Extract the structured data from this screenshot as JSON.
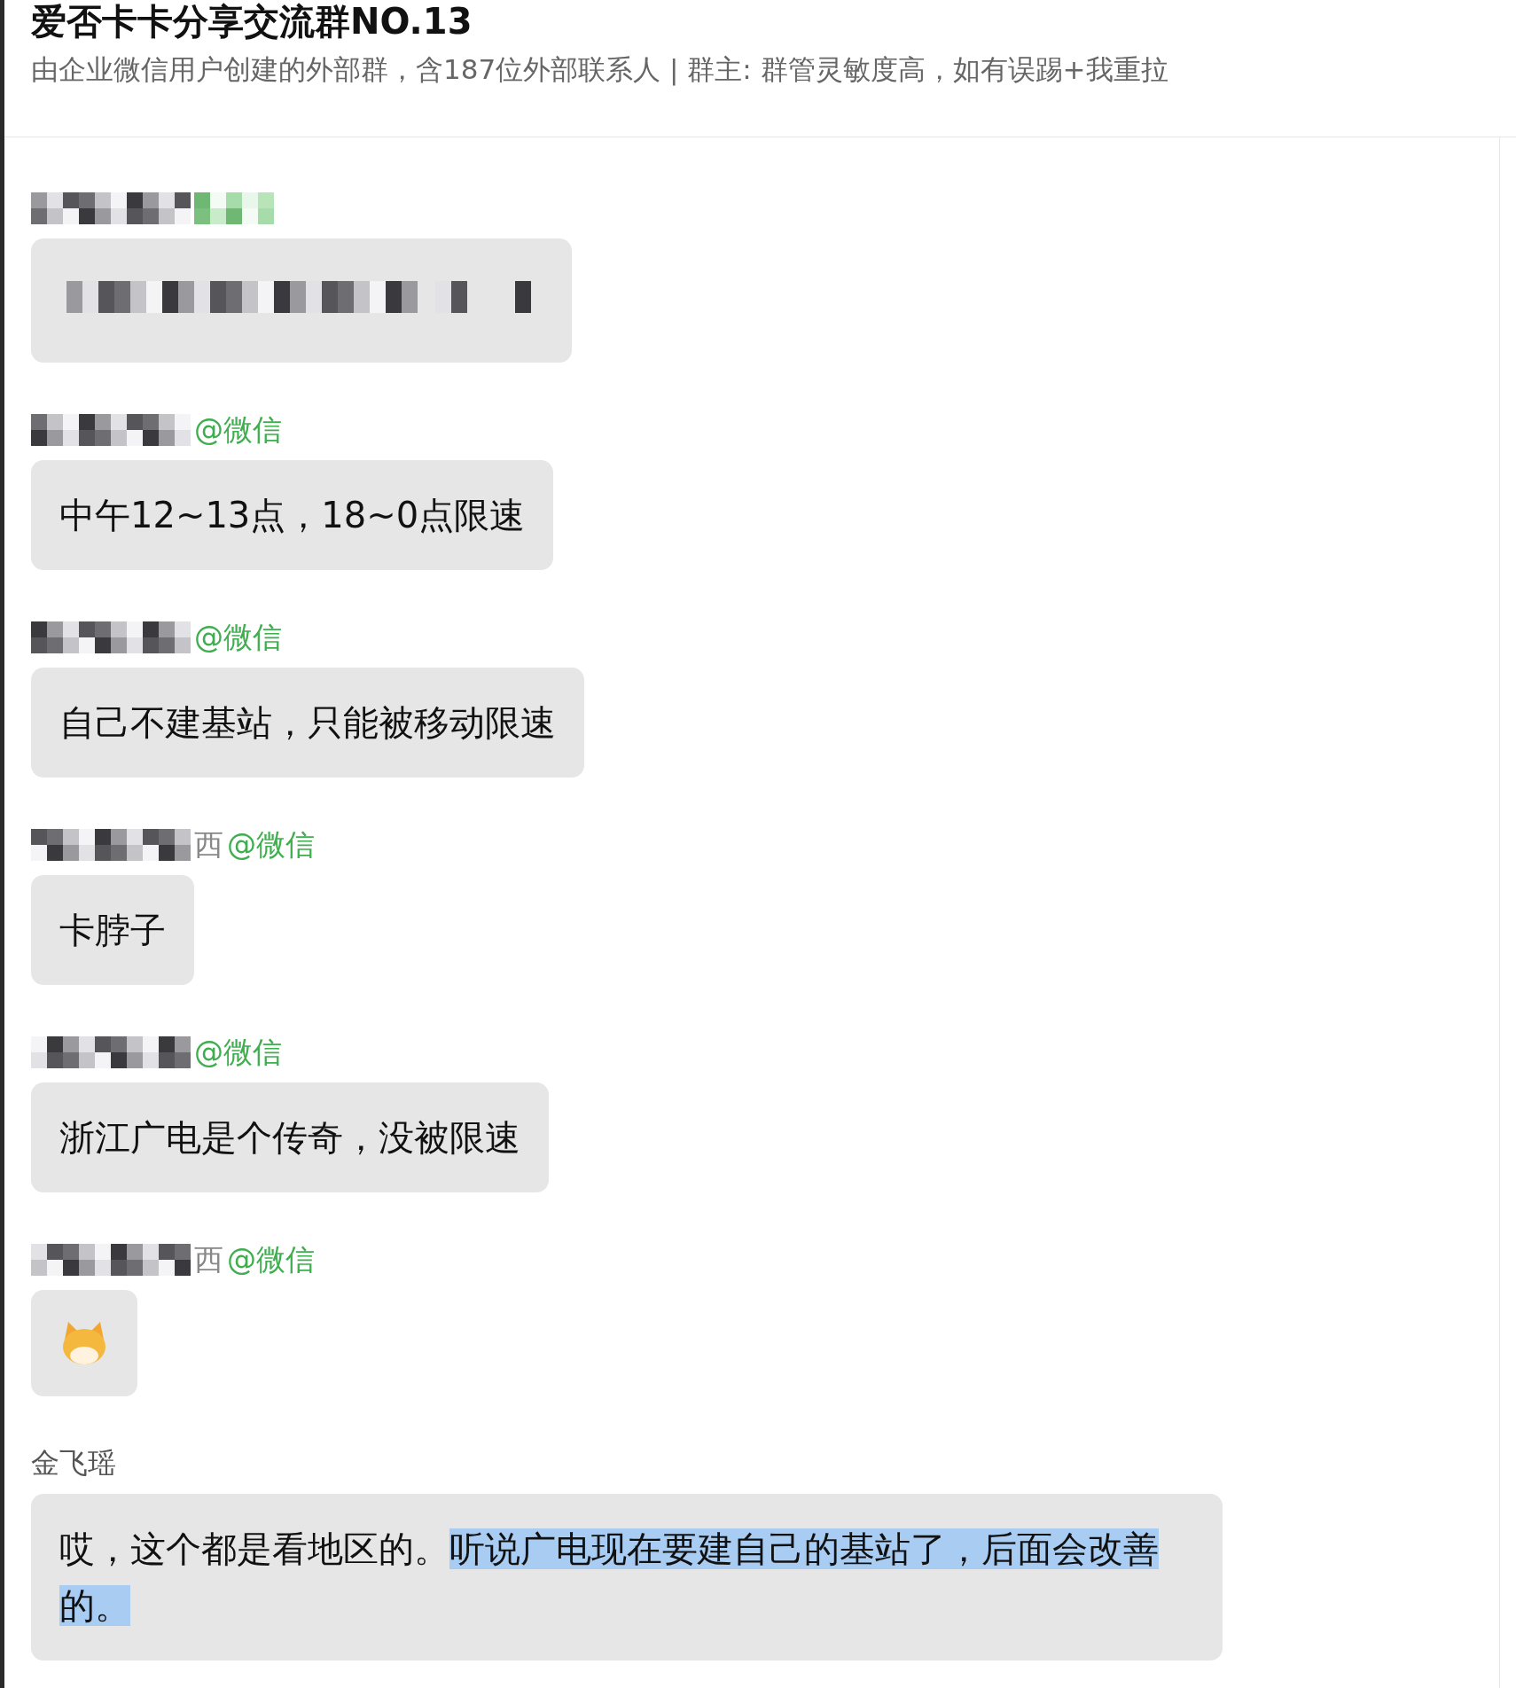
{
  "header": {
    "title": "爱否卡卡分享交流群NO.13",
    "subtitle": "由企业微信用户创建的外部群，含187位外部联系人 | 群主: 群管灵敏度高，如有误踢+我重拉"
  },
  "messages": [
    {
      "sender": {
        "redacted": true,
        "tag_redacted": true
      },
      "content": {
        "kind": "redacted"
      }
    },
    {
      "sender": {
        "redacted": true,
        "tag": "@微信"
      },
      "content": {
        "kind": "text",
        "parts": [
          {
            "text": "中午12~13点，18~0点限速",
            "selected": false
          }
        ]
      }
    },
    {
      "sender": {
        "redacted": true,
        "tag": "@微信"
      },
      "content": {
        "kind": "text",
        "parts": [
          {
            "text": "自己不建基站，只能被移动限速",
            "selected": false
          }
        ]
      }
    },
    {
      "sender": {
        "redacted": true,
        "tail": "西",
        "tag": "@微信"
      },
      "content": {
        "kind": "text",
        "parts": [
          {
            "text": "卡脖子",
            "selected": false
          }
        ]
      }
    },
    {
      "sender": {
        "redacted": true,
        "tag": "@微信"
      },
      "content": {
        "kind": "text",
        "parts": [
          {
            "text": "浙江广电是个传奇，没被限速",
            "selected": false
          }
        ]
      }
    },
    {
      "sender": {
        "redacted": true,
        "tail": "西",
        "tag": "@微信"
      },
      "content": {
        "kind": "sticker"
      }
    },
    {
      "sender": {
        "redacted": false,
        "name": "金飞瑶"
      },
      "content": {
        "kind": "text",
        "parts": [
          {
            "text": "哎，这个都是看地区的。",
            "selected": false
          },
          {
            "text": "听说广电现在要建自己的基站了，后面会改善的。",
            "selected": true
          }
        ]
      }
    }
  ]
}
